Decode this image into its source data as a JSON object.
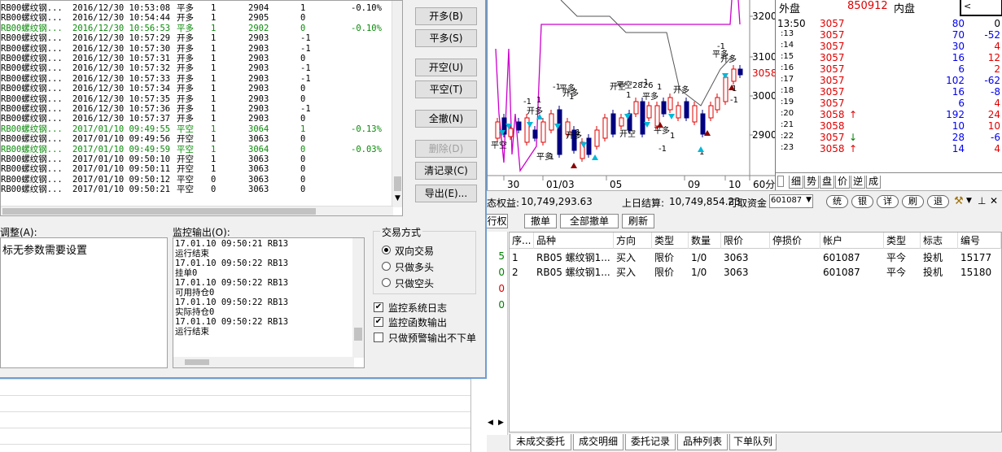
{
  "signal_list": {
    "rows": [
      {
        "contract": "RB00螺纹钢...",
        "time": "2016/12/30 10:53:08",
        "action": "平多",
        "qty": "1",
        "price": "2904",
        "pos": "1",
        "ratio": "-0.10%",
        "green": false
      },
      {
        "contract": "RB00螺纹钢...",
        "time": "2016/12/30 10:54:44",
        "action": "开多",
        "qty": "1",
        "price": "2905",
        "pos": "0",
        "ratio": "",
        "green": false
      },
      {
        "contract": "RB00螺纹钢...",
        "time": "2016/12/30 10:56:53",
        "action": "平多",
        "qty": "1",
        "price": "2902",
        "pos": "0",
        "ratio": "-0.10%",
        "green": true
      },
      {
        "contract": "RB00螺纹钢...",
        "time": "2016/12/30 10:57:29",
        "action": "开多",
        "qty": "1",
        "price": "2903",
        "pos": "-1",
        "ratio": "",
        "green": false
      },
      {
        "contract": "RB00螺纹钢...",
        "time": "2016/12/30 10:57:30",
        "action": "开多",
        "qty": "1",
        "price": "2903",
        "pos": "-1",
        "ratio": "",
        "green": false
      },
      {
        "contract": "RB00螺纹钢...",
        "time": "2016/12/30 10:57:31",
        "action": "开多",
        "qty": "1",
        "price": "2903",
        "pos": "0",
        "ratio": "",
        "green": false
      },
      {
        "contract": "RB00螺纹钢...",
        "time": "2016/12/30 10:57:32",
        "action": "开多",
        "qty": "1",
        "price": "2903",
        "pos": "-1",
        "ratio": "",
        "green": false
      },
      {
        "contract": "RB00螺纹钢...",
        "time": "2016/12/30 10:57:33",
        "action": "开多",
        "qty": "1",
        "price": "2903",
        "pos": "-1",
        "ratio": "",
        "green": false
      },
      {
        "contract": "RB00螺纹钢...",
        "time": "2016/12/30 10:57:34",
        "action": "开多",
        "qty": "1",
        "price": "2903",
        "pos": "0",
        "ratio": "",
        "green": false
      },
      {
        "contract": "RB00螺纹钢...",
        "time": "2016/12/30 10:57:35",
        "action": "开多",
        "qty": "1",
        "price": "2903",
        "pos": "0",
        "ratio": "",
        "green": false
      },
      {
        "contract": "RB00螺纹钢...",
        "time": "2016/12/30 10:57:36",
        "action": "开多",
        "qty": "1",
        "price": "2903",
        "pos": "-1",
        "ratio": "",
        "green": false
      },
      {
        "contract": "RB00螺纹钢...",
        "time": "2016/12/30 10:57:37",
        "action": "开多",
        "qty": "1",
        "price": "2903",
        "pos": "0",
        "ratio": "",
        "green": false
      },
      {
        "contract": "RB00螺纹钢...",
        "time": "2017/01/10 09:49:55",
        "action": "平空",
        "qty": "1",
        "price": "3064",
        "pos": "1",
        "ratio": "-0.13%",
        "green": true
      },
      {
        "contract": "RB00螺纹钢...",
        "time": "2017/01/10 09:49:56",
        "action": "开空",
        "qty": "1",
        "price": "3063",
        "pos": "0",
        "ratio": "",
        "green": false
      },
      {
        "contract": "RB00螺纹钢...",
        "time": "2017/01/10 09:49:59",
        "action": "平空",
        "qty": "1",
        "price": "3064",
        "pos": "0",
        "ratio": "-0.03%",
        "green": true
      },
      {
        "contract": "RB00螺纹钢...",
        "time": "2017/01/10 09:50:10",
        "action": "开空",
        "qty": "1",
        "price": "3063",
        "pos": "0",
        "ratio": "",
        "green": false
      },
      {
        "contract": "RB00螺纹钢...",
        "time": "2017/01/10 09:50:11",
        "action": "开空",
        "qty": "1",
        "price": "3063",
        "pos": "0",
        "ratio": "",
        "green": false
      },
      {
        "contract": "RB00螺纹钢...",
        "time": "2017/01/10 09:50:12",
        "action": "平空",
        "qty": "0",
        "price": "3063",
        "pos": "0",
        "ratio": "",
        "green": false
      },
      {
        "contract": "RB00螺纹钢...",
        "time": "2017/01/10 09:50:21",
        "action": "平空",
        "qty": "0",
        "price": "3063",
        "pos": "0",
        "ratio": "",
        "green": false
      }
    ]
  },
  "dialog_buttons": {
    "open_long": "开多(B)",
    "close_long": "平多(S)",
    "open_short": "开空(U)",
    "close_short": "平空(T)",
    "cancel_all": "全撤(N)",
    "delete": "删除(D)",
    "clear_log": "清记录(C)",
    "export": "导出(E)..."
  },
  "param_panel": {
    "label": "调整(A):",
    "text": "标无参数需要设置"
  },
  "monitor": {
    "label": "监控输出(O):",
    "lines": [
      "17.01.10 09:50:21 RB13",
      "运行结束",
      "17.01.10 09:50:22 RB13",
      "挂单0",
      "17.01.10 09:50:22 RB13",
      "可用持仓0",
      "17.01.10 09:50:22 RB13",
      "实际持仓0",
      "17.01.10 09:50:22 RB13",
      "运行结束"
    ]
  },
  "trade_mode": {
    "title": "交易方式",
    "options": [
      {
        "label": "双向交易",
        "selected": true
      },
      {
        "label": "只做多头",
        "selected": false
      },
      {
        "label": "只做空头",
        "selected": false
      }
    ]
  },
  "checkboxes": [
    {
      "label": "监控系统日志",
      "checked": true
    },
    {
      "label": "监控函数输出",
      "checked": true
    },
    {
      "label": "只做预警输出不下单",
      "checked": false
    }
  ],
  "chart": {
    "y_ticks": [
      "3200",
      "3100",
      "3000",
      "2900"
    ],
    "last_price": "3058",
    "x_ticks": [
      "30",
      "01/03",
      "05",
      "09",
      "10",
      "60分"
    ],
    "purple": "#cc00cc",
    "annotations": [
      "平空",
      "-1",
      "开多",
      "1",
      "平多",
      "-1",
      "开多",
      "1",
      "平多",
      "-1",
      "开多",
      "1",
      "平空2826",
      "开空",
      "1",
      "开空",
      "1",
      "平多",
      "-1",
      "开多",
      "1",
      "-1",
      "平多",
      "1",
      "-1",
      "开多",
      "1",
      "-1",
      "平多"
    ]
  },
  "quote_panel": {
    "outer_label": "外盘",
    "outer_value": "850912",
    "inner_label": "内盘",
    "start_time": "13:50",
    "ticks": [
      {
        "time": ":13",
        "price": "3057",
        "vol": "70",
        "chg": "-52",
        "arrow": ""
      },
      {
        "time": ":14",
        "price": "3057",
        "vol": "30",
        "chg": "4",
        "arrow": ""
      },
      {
        "time": ":15",
        "price": "3057",
        "vol": "16",
        "chg": "12",
        "arrow": ""
      },
      {
        "time": ":16",
        "price": "3057",
        "vol": "6",
        "chg": "2",
        "arrow": ""
      },
      {
        "time": ":17",
        "price": "3057",
        "vol": "102",
        "chg": "-62",
        "arrow": ""
      },
      {
        "time": ":18",
        "price": "3057",
        "vol": "16",
        "chg": "-8",
        "arrow": ""
      },
      {
        "time": ":19",
        "price": "3057",
        "vol": "6",
        "chg": "4",
        "arrow": ""
      },
      {
        "time": ":20",
        "price": "3058",
        "vol": "192",
        "chg": "24",
        "arrow": "↑"
      },
      {
        "time": ":21",
        "price": "3058",
        "vol": "10",
        "chg": "10",
        "arrow": ""
      },
      {
        "time": ":22",
        "price": "3057",
        "vol": "28",
        "chg": "-6",
        "arrow": "↓"
      },
      {
        "time": ":23",
        "price": "3058",
        "vol": "14",
        "chg": "4",
        "arrow": "↑"
      }
    ],
    "first_tick": {
      "price": "3057",
      "vol": "80",
      "chg": "0"
    },
    "tabs": [
      "细",
      "势",
      "盘",
      "价",
      "逆",
      "成"
    ]
  },
  "account": {
    "equity_label": "态权益:",
    "equity": "10,749,293.63",
    "prev_label": "上日结算:",
    "prev": "10,749,854.23",
    "avail_label": "可取资金",
    "account_no": "601087",
    "tool_buttons": [
      "统",
      "银",
      "详",
      "刷",
      "退"
    ]
  },
  "order_toolbar": {
    "rights": "行权",
    "cancel": "撤单",
    "cancel_all": "全部撤单",
    "refresh": "刷新"
  },
  "order_table": {
    "headers": [
      "序...",
      "品种",
      "方向",
      "类型",
      "数量",
      "限价",
      "停损价",
      "帐户",
      "类型",
      "标志",
      "编号"
    ],
    "rows": [
      [
        "1",
        "RB05 螺纹钢1...",
        "买入",
        "限价",
        "1/0",
        "3063",
        "",
        "601087",
        "平今",
        "投机",
        "15177"
      ],
      [
        "2",
        "RB05 螺纹钢1...",
        "买入",
        "限价",
        "1/0",
        "3063",
        "",
        "601087",
        "平今",
        "投机",
        "15180"
      ]
    ]
  },
  "left_strip_values": [
    "5",
    "0",
    "0",
    "0"
  ],
  "bottom_tabs": [
    "未成交委托",
    "成交明细",
    "委托记录",
    "品种列表",
    "下单队列"
  ]
}
